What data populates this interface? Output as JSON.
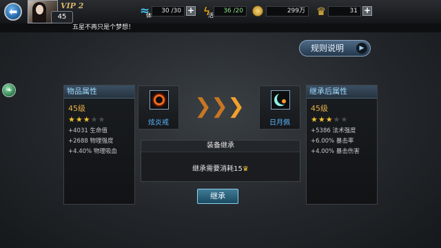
{
  "player": {
    "vip": "VIP 2",
    "level": "45"
  },
  "resources": {
    "energy": {
      "value": "30 /30",
      "label": "体"
    },
    "vitality": {
      "value": "36 /20",
      "label": "活"
    },
    "coins": {
      "value": "299万"
    },
    "gold": {
      "value": "31"
    }
  },
  "announcement": "五星不再只是个梦想！",
  "rules_button": "规则说明",
  "left_panel": {
    "title": "物品属性",
    "level": "45级",
    "stars_filled": 3,
    "stars_total": 5,
    "stats": [
      "+4031 生命值",
      "+2688 物理强度",
      "+4.40% 物理吸血"
    ]
  },
  "right_panel": {
    "title": "继承后属性",
    "level": "45级",
    "stars_filled": 3,
    "stars_total": 5,
    "stats": [
      "+5386 法术强度",
      "+6.00% 暴击率",
      "+4.00% 暴击伤害"
    ]
  },
  "source_item": {
    "name": "炫炎戒",
    "icon": "fire-ring-icon"
  },
  "target_item": {
    "name": "日月佩",
    "icon": "sun-moon-pendant-icon"
  },
  "inherit_section": {
    "title": "装备继承",
    "cost_text": "继承需要消耗15"
  },
  "inherit_button": "继承",
  "colors": {
    "accent_blue": "#5ab8ff",
    "level_orange": "#e8b04a",
    "star_gold": "#f2c230",
    "header_cyan": "#9fdcff"
  }
}
